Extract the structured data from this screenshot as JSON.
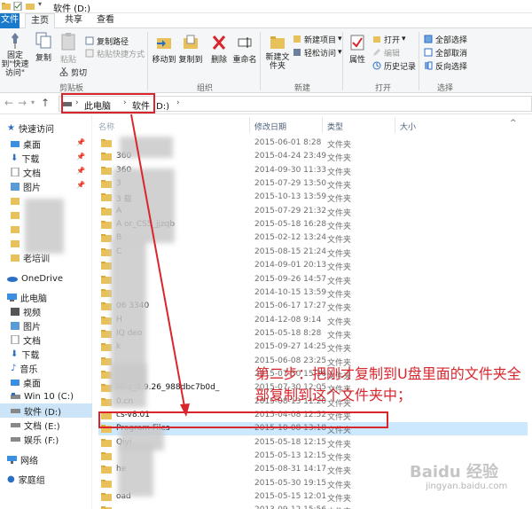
{
  "window": {
    "title": "软件 (D:)"
  },
  "tabs": [
    {
      "label": "文件"
    },
    {
      "label": "主页"
    },
    {
      "label": "共享"
    },
    {
      "label": "查看"
    }
  ],
  "ribbon": {
    "clipboard": {
      "pin_label": "固定到\"快速访问\"",
      "copy_label": "复制",
      "paste_label": "粘贴",
      "copy_path_label": "复制路径",
      "paste_shortcut_label": "粘贴快捷方式",
      "cut_label": "剪切",
      "group_label": "剪贴板"
    },
    "organize": {
      "move_to_label": "移动到",
      "copy_to_label": "复制到",
      "delete_label": "删除",
      "rename_label": "重命名",
      "group_label": "组织"
    },
    "new": {
      "new_folder_label": "新建文件夹",
      "new_item_label": "新建项目",
      "easy_access_label": "轻松访问",
      "group_label": "新建"
    },
    "open": {
      "properties_label": "属性",
      "open_label": "打开",
      "edit_label": "编辑",
      "history_label": "历史记录",
      "group_label": "打开"
    },
    "select": {
      "select_all_label": "全部选择",
      "select_none_label": "全部取消",
      "invert_label": "反向选择",
      "group_label": "选择"
    }
  },
  "address": {
    "crumbs": [
      "此电脑",
      "软件 (D:)"
    ]
  },
  "nav": {
    "quick_access": "快速访问",
    "desktop": "桌面",
    "downloads": "下载",
    "documents": "文档",
    "pictures": "图片",
    "onedrive": "OneDrive",
    "this_pc": "此电脑",
    "videos": "视频",
    "pc_pictures": "图片",
    "pc_documents": "文档",
    "pc_downloads": "下载",
    "music": "音乐",
    "pc_desktop": "桌面",
    "drive_c": "Win 10 (C:)",
    "drive_d": "软件 (D:)",
    "drive_e": "文档 (E:)",
    "drive_f": "娱乐 (F:)",
    "network": "网络",
    "homegroup": "家庭组"
  },
  "columns": {
    "name": "名称",
    "date": "修改日期",
    "type": "类型",
    "size": "大小"
  },
  "files": [
    {
      "name": "",
      "date": "2015-06-01 8:28",
      "type": "文件夹"
    },
    {
      "name": "360",
      "date": "2015-04-24 23:49",
      "type": "文件夹"
    },
    {
      "name": "360",
      "date": "2014-09-30 11:33",
      "type": "文件夹"
    },
    {
      "name": "3",
      "date": "2015-07-29 13:50",
      "type": "文件夹"
    },
    {
      "name": "3 载",
      "date": "2015-10-13 13:59",
      "type": "文件夹"
    },
    {
      "name": "A",
      "date": "2015-07-29 21:32",
      "type": "文件夹"
    },
    {
      "name": "A or_CS5_jjzqb",
      "date": "2015-05-18 16:28",
      "type": "文件夹"
    },
    {
      "name": "B",
      "date": "2015-02-12 13:24",
      "type": "文件夹"
    },
    {
      "name": "C",
      "date": "2015-08-15 21:24",
      "type": "文件夹"
    },
    {
      "name": "",
      "date": "2014-09-01 20:13",
      "type": "文件夹"
    },
    {
      "name": "",
      "date": "2015-09-26 14:57",
      "type": "文件夹"
    },
    {
      "name": "",
      "date": "2014-10-15 13:59",
      "type": "文件夹"
    },
    {
      "name": "06 3340",
      "date": "2015-06-17 17:27",
      "type": "文件夹"
    },
    {
      "name": "H",
      "date": "2014-12-08 9:14",
      "type": "文件夹"
    },
    {
      "name": "IQ deo",
      "date": "2015-05-18 8:28",
      "type": "文件夹"
    },
    {
      "name": "k",
      "date": "2015-09-27 14:25",
      "type": "文件夹"
    },
    {
      "name": "",
      "date": "2015-06-08 23:25",
      "type": "文件夹"
    },
    {
      "name": "",
      "date": "2015-07-30 15:36",
      "type": "文件夹"
    },
    {
      "name": "Mi s_4.9.26_988dbc7b0d_",
      "date": "2015-07-30 12:05",
      "type": "文件夹"
    },
    {
      "name": "0.cn",
      "date": "2015-08-13 11:20",
      "type": "文件夹"
    },
    {
      "name": "cs-v8.01",
      "date": "2015-04-08 12:52",
      "type": "文件夹"
    },
    {
      "name": "Program Files",
      "date": "2015-10-08 13:18",
      "type": "文件夹"
    },
    {
      "name": "Qiyi",
      "date": "2015-05-18 12:15",
      "type": "文件夹"
    },
    {
      "name": "",
      "date": "2015-05-13 12:15",
      "type": "文件夹"
    },
    {
      "name": "he",
      "date": "2015-08-31 14:17",
      "type": "文件夹"
    },
    {
      "name": "",
      "date": "2015-05-30 19:15",
      "type": "文件夹"
    },
    {
      "name": "oad",
      "date": "2015-05-15 12:01",
      "type": "文件夹"
    },
    {
      "name": "",
      "date": "2013-09-12 15:56",
      "type": "文件夹"
    },
    {
      "name": "WDIDownload",
      "date": "2015-05-13 12:22",
      "type": "文件夹"
    }
  ],
  "annotation": {
    "text": "第二步：把刚才复制到U盘里面的文件夹全部复制到这个文件夹中；",
    "color": "#d8262c"
  },
  "watermark": {
    "text": "Baidu 经验",
    "sub": "jingyan.baidu.com"
  }
}
